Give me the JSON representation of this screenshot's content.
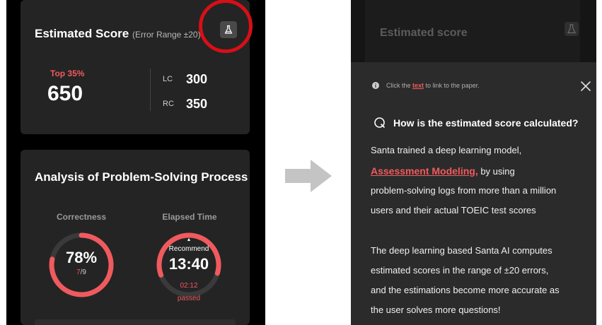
{
  "left": {
    "score_title": "Estimated Score",
    "error_range": "(Error Range ±20)",
    "top_percent": "Top 35%",
    "estimated_score": "650",
    "lc_label": "LC",
    "lc_score": "300",
    "rc_label": "RC",
    "rc_score": "350",
    "analysis_title": "Analysis of Problem-Solving Process",
    "correctness_label": "Correctness",
    "correctness_percent": "78%",
    "correct_count": "7",
    "total_count": "/9",
    "correctness_fraction": 0.78,
    "elapsed_label": "Elapsed Time",
    "recommend_label": "Recommend",
    "elapsed_time": "13:40",
    "passed_time": "02:12",
    "passed_label": "passed",
    "elapsed_fraction": 0.6
  },
  "right": {
    "dim_title": "Estimated score",
    "info_prefix": "Click the ",
    "info_link": "text",
    "info_suffix": " to link to the paper.",
    "question": "How is the estimated score calculated?",
    "p1_line1": "Santa trained a deep learning model,",
    "p1_link": "Assessment Modeling,",
    "p1_line2_rest": " by using",
    "p1_line3": "problem-solving logs from more than a million",
    "p1_line4": "users and their actual TOEIC test scores",
    "p2_line1": "The deep learning based Santa AI computes",
    "p2_line2": "estimated scores in the range of ±20 errors,",
    "p2_line3": "and the estimations become more accurate as",
    "p2_line4": "the user solves more questions!"
  },
  "colors": {
    "accent_red": "#f05a5e",
    "highlight_red": "#d70f17",
    "card_bg": "#242424"
  }
}
